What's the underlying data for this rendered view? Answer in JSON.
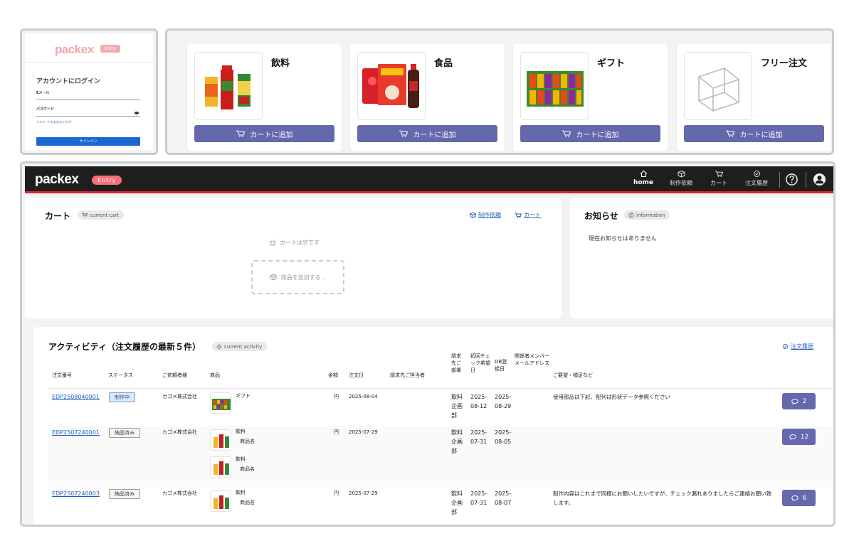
{
  "login": {
    "logo": "packex",
    "badge": "Entry",
    "title": "アカウントにログイン",
    "email_label": "Eメール",
    "password_label": "パスワード",
    "forgot": "パスワードをお忘れですか？",
    "signin": "サインイン"
  },
  "products": [
    {
      "name": "飲料",
      "button": "カートに追加"
    },
    {
      "name": "食品",
      "button": "カートに追加"
    },
    {
      "name": "ギフト",
      "button": "カートに追加"
    },
    {
      "name": "フリー注文",
      "button": "カートに追加"
    }
  ],
  "app": {
    "brand": "packex",
    "badge": "Entry",
    "nav": [
      {
        "label": "home",
        "icon": "home-icon"
      },
      {
        "label": "制作依頼",
        "icon": "cube-icon"
      },
      {
        "label": "カート",
        "icon": "cart-icon"
      },
      {
        "label": "注文履歴",
        "icon": "history-icon"
      }
    ]
  },
  "cart": {
    "title": "カート",
    "pill": "current cart",
    "link_request": "制作依頼",
    "link_cart": "カート",
    "empty": "カートは空です",
    "add_placeholder": "商品を追加する..."
  },
  "news": {
    "title": "お知らせ",
    "pill": "information",
    "message": "現在お知らせはありません"
  },
  "activity": {
    "title": "アクティビティ（注文履歴の最新５件）",
    "pill": "current activity",
    "link_history": "注文履歴",
    "headers": [
      "注文番号",
      "ステータス",
      "ご依頼者様",
      "商品",
      "金額",
      "注文日",
      "請求先ご担当者",
      "請求先ご部署",
      "初回チェック希望日",
      "DB登録日",
      "関係者メンバーメールアドレス",
      "ご要望・補足など"
    ],
    "rows": [
      {
        "order": "EDP2508040001",
        "status": "制作中",
        "client": "カゴメ株式会社",
        "items": [
          {
            "cat": "ギフト",
            "name": ""
          }
        ],
        "amount": "円",
        "date": "2025-08-04",
        "dept": "飲料企画部",
        "check": "2025-08-12",
        "db": "2025-08-29",
        "note": "使用部品は下記、配列は形状データ参照ください",
        "comments": "2"
      },
      {
        "order": "EDP2507240001",
        "status": "納品済み",
        "client": "カゴメ株式会社",
        "items": [
          {
            "cat": "飲料",
            "name": "商品名"
          },
          {
            "cat": "飲料",
            "name": "商品名"
          }
        ],
        "amount": "円",
        "date": "2025-07-29",
        "dept": "飲料企画部",
        "check": "2025-07-31",
        "db": "2025-08-05",
        "note": "",
        "comments": "12"
      },
      {
        "order": "EDP2507240003",
        "status": "納品済み",
        "client": "カゴメ株式会社",
        "items": [
          {
            "cat": "飲料",
            "name": "商品名"
          }
        ],
        "amount": "円",
        "date": "2025-07-29",
        "dept": "飲料企画部",
        "check": "2025-07-31",
        "db": "2025-08-07",
        "note": "制作内容はこれまで同様にお願いしたいですが、チェック漏れありましたらご連絡お願い致します。",
        "comments": "6"
      }
    ]
  }
}
